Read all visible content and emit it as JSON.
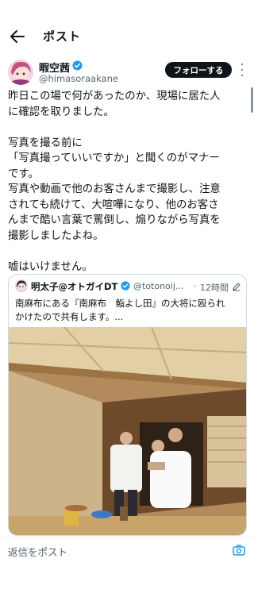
{
  "header": {
    "title": "ポスト",
    "back_icon": "arrow-left-icon"
  },
  "author": {
    "display_name": "暇空茜",
    "handle": "@himasoraakane",
    "verified": true,
    "follow_label": "フォローする"
  },
  "tweet": {
    "lines": [
      "昨日この場で何があったのか、現場に居た人",
      "に確認を取りました。",
      "",
      "写真を撮る前に",
      "「写真撮っていいですか」と聞くのがマナー",
      "です。",
      "写真や動画で他のお客さんまで撮影し、注意",
      "されても続けて、大喧嘩になり、他のお客さ",
      "んまで酷い言葉で罵倒し、煽りながら写真を",
      "撮影しましたよね。",
      "",
      "嘘はいけません。"
    ]
  },
  "quote": {
    "display_name": "明太子@オトガイDT",
    "handle": "@totonoij...",
    "separator": "·",
    "time": "12時間",
    "lines": [
      "南麻布にある『南麻布　鮨よし田』の大将に殴られ",
      "かけたので共有します。..."
    ]
  },
  "reply": {
    "placeholder": "返信をポスト"
  },
  "colors": {
    "accent": "#1d9bf0",
    "text": "#0f1419",
    "muted": "#536471"
  }
}
